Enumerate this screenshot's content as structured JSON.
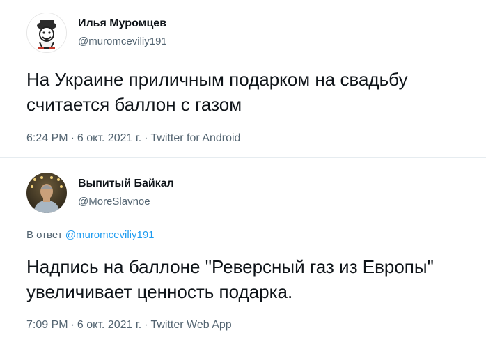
{
  "tweets": [
    {
      "author_name": "Илья Муромцев",
      "handle": "@muromceviliy191",
      "text_line1": "На Украине приличным подарком на свадьбу",
      "text_line2": "считается баллон с газом",
      "time": "6:24 PM",
      "date": "6 окт. 2021 г.",
      "source": "Twitter for Android",
      "separator": "·",
      "avatar_icon": "cartoon-face-icon"
    },
    {
      "author_name": "Выпитый Байкал",
      "handle": "@MoreSlavnoe",
      "reply_prefix": "В ответ",
      "reply_to": "@muromceviliy191",
      "text_line1": "Надпись на баллоне \"Реверсный газ из Европы\"",
      "text_line2": "увеличивает ценность подарка.",
      "time": "7:09 PM",
      "date": "6 окт. 2021 г.",
      "source": "Twitter Web App",
      "separator": "·",
      "avatar_icon": "person-photo-icon"
    }
  ],
  "colors": {
    "text_primary": "#0f1419",
    "text_secondary": "#536471",
    "link": "#1d9bf0",
    "divider": "#e6ecf0"
  }
}
